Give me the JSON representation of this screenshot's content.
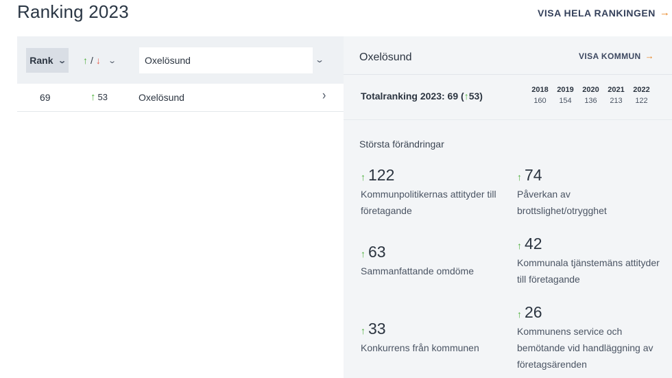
{
  "header": {
    "title": "Ranking 2023",
    "view_all_label": "VISA HELA RANKINGEN",
    "arrow": "→"
  },
  "table": {
    "rank_header": "Rank",
    "change_header": {
      "up": "↑",
      "sep": "/",
      "down": "↓"
    },
    "chevron": "⌄",
    "search_value": "Oxelösund",
    "rows": [
      {
        "rank": "69",
        "change_arrow": "↑",
        "change": "53",
        "name": "Oxelösund",
        "go": "›"
      }
    ]
  },
  "panel": {
    "title": "Oxelösund",
    "view_kommun_label": "VISA KOMMUN",
    "arrow": "→",
    "total": {
      "prefix": "Totalranking 2023: 69 (",
      "arrow": "↑",
      "value": "53",
      "suffix": ")"
    },
    "years": [
      {
        "year": "2018",
        "rank": "160"
      },
      {
        "year": "2019",
        "rank": "154"
      },
      {
        "year": "2020",
        "rank": "136"
      },
      {
        "year": "2021",
        "rank": "213"
      },
      {
        "year": "2022",
        "rank": "122"
      }
    ],
    "changes_heading": "Största förändringar",
    "changes": [
      {
        "arrow": "↑",
        "value": "122",
        "label": "Kommunpolitikernas attityder till företagande"
      },
      {
        "arrow": "↑",
        "value": "74",
        "label": "Påverkan av brottslighet/otrygghet"
      },
      {
        "arrow": "↑",
        "value": "63",
        "label": "Sammanfattande omdöme"
      },
      {
        "arrow": "↑",
        "value": "42",
        "label": "Kommunala tjänstemäns attityder till företagande"
      },
      {
        "arrow": "↑",
        "value": "33",
        "label": "Konkurrens från kommunen"
      },
      {
        "arrow": "↑",
        "value": "26",
        "label": "Kommunens service och bemötande vid handläggning av företagsärenden"
      }
    ]
  },
  "colors": {
    "accent_orange": "#e8801a",
    "up_green": "#4caf3a",
    "down_red": "#e65a4a"
  }
}
